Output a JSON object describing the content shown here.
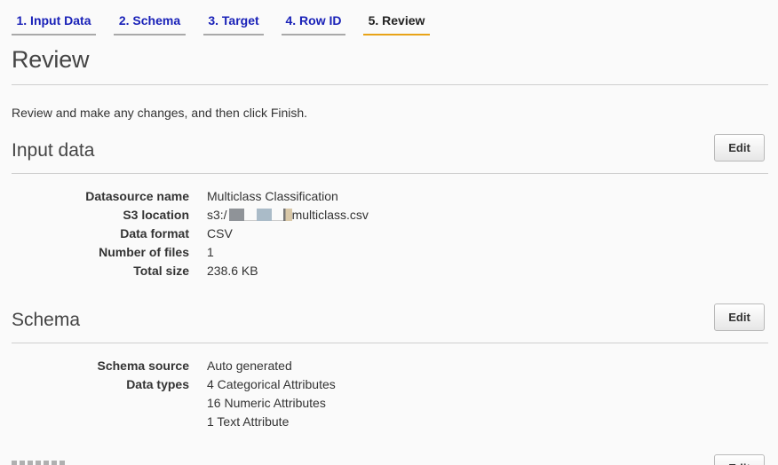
{
  "tabs": [
    {
      "label": "1. Input Data"
    },
    {
      "label": "2. Schema"
    },
    {
      "label": "3. Target"
    },
    {
      "label": "4. Row ID"
    },
    {
      "label": "5. Review",
      "active": true
    }
  ],
  "page": {
    "title": "Review",
    "intro": "Review and make any changes, and then click Finish."
  },
  "input_data": {
    "title": "Input data",
    "edit_label": "Edit",
    "fields": [
      {
        "label": "Datasource name",
        "value": "Multiclass Classification"
      },
      {
        "label": "S3 location",
        "value_prefix": "s3:/",
        "value_suffix": "multiclass.csv"
      },
      {
        "label": "Data format",
        "value": "CSV"
      },
      {
        "label": "Number of files",
        "value": "1"
      },
      {
        "label": "Total size",
        "value": "238.6 KB"
      }
    ]
  },
  "schema": {
    "title": "Schema",
    "edit_label": "Edit",
    "fields": [
      {
        "label": "Schema source",
        "value": "Auto generated"
      },
      {
        "label": "Data types",
        "values": [
          "4 Categorical Attributes",
          "16 Numeric Attributes",
          "1 Text Attribute"
        ]
      }
    ]
  },
  "target": {
    "edit_label": "Edit"
  },
  "colors": {
    "link": "#1a22b8",
    "active_tab_underline": "#e8a317"
  }
}
